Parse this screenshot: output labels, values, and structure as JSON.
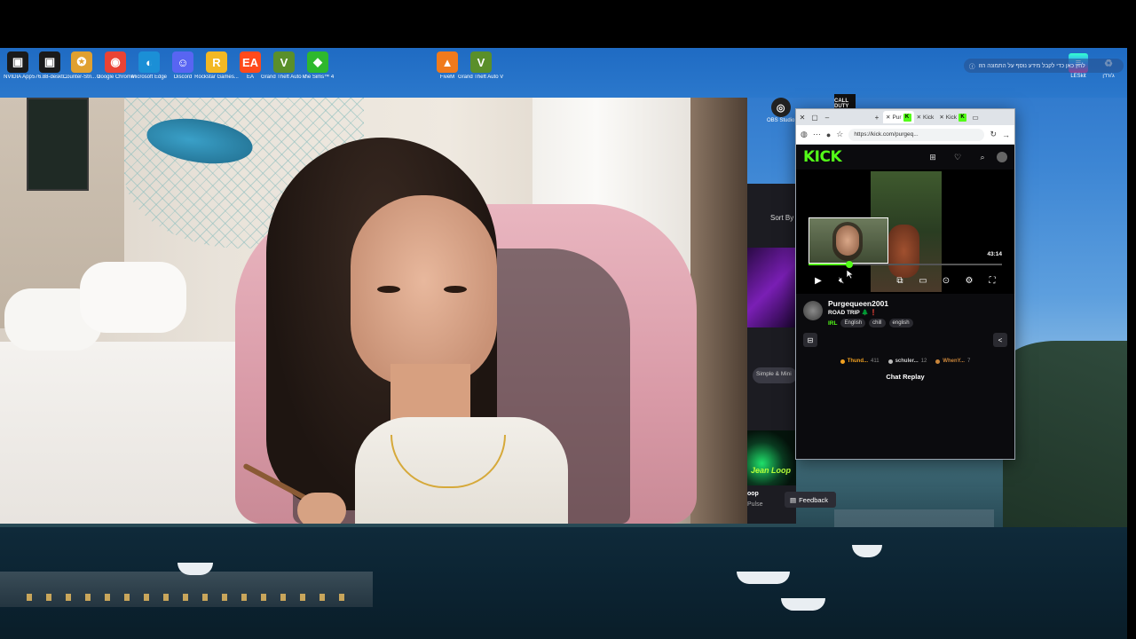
{
  "desktop": {
    "icons": [
      {
        "label": "NVIDIA App",
        "icon": "nvidia-app-icon",
        "color": "#1a1a1a",
        "glyph": "▣"
      },
      {
        "label": "576.88-deskt...",
        "icon": "nvidia-driver-icon",
        "color": "#1a1a1a",
        "glyph": "▣"
      },
      {
        "label": "Counter-Stri... 2",
        "icon": "counter-strike-icon",
        "color": "#e0a030",
        "glyph": "✪"
      },
      {
        "label": "Google Chrome",
        "icon": "chrome-icon",
        "color": "#ea4335",
        "glyph": "◉"
      },
      {
        "label": "Microsoft Edge",
        "icon": "edge-icon",
        "color": "#1b8fd6",
        "glyph": "◐"
      },
      {
        "label": "Discord",
        "icon": "discord-icon",
        "color": "#5865f2",
        "glyph": "☺"
      },
      {
        "label": "Rockstar Games...",
        "icon": "rockstar-icon",
        "color": "#f2b824",
        "glyph": "R"
      },
      {
        "label": "EA",
        "icon": "ea-icon",
        "color": "#ff4a1c",
        "glyph": "EA"
      },
      {
        "label": "Grand Theft Auto V Le...",
        "icon": "gta-v-icon",
        "color": "#5a8f2a",
        "glyph": "V"
      },
      {
        "label": "The Sims™ 4",
        "icon": "sims-icon",
        "color": "#2eb82e",
        "glyph": "◆"
      },
      {
        "label": "FiveM",
        "icon": "fivem-icon",
        "color": "#f07a1c",
        "glyph": "▲"
      },
      {
        "label": "Grand Theft Auto V Le...",
        "icon": "gta-v-icon",
        "color": "#5a8f2a",
        "glyph": "V"
      }
    ],
    "right_icons": [
      {
        "label": "OBS Studio",
        "icon": "obs-icon"
      },
      {
        "label": "CALL DUTY",
        "icon": "call-of-duty-icon"
      },
      {
        "label": "LESkit",
        "icon": "app-icon"
      },
      {
        "label": "ג'ורדן",
        "icon": "recycle-bin-icon"
      }
    ],
    "notification": "לחץ כאן כדי לקבל מידע נוסף על התמונה הזו"
  },
  "background_window": {
    "sort_label": "Sort By",
    "pill_label": "Simple & Mini",
    "thumb_text": "Jean Loop",
    "item_title": "oop",
    "item_sub": "Pulse",
    "feedback_label": "Feedback"
  },
  "browser": {
    "tabs": [
      {
        "label": "Pur",
        "active": true
      },
      {
        "label": "Kick",
        "active": false
      },
      {
        "label": "Kick",
        "active": false
      }
    ],
    "tab_badge": "K",
    "url": "https://kick.com/purgeq...",
    "kick_logo": "KICK",
    "player": {
      "timestamp": "43:14",
      "progress": 0.21
    },
    "channel": {
      "name": "Purgequeen2001",
      "title": "ROAD TRIP 🌲 ❗",
      "category": "IRL",
      "tags": [
        "English",
        "chill",
        "english"
      ]
    },
    "leaderboard": [
      {
        "name": "Thund...",
        "count": "411",
        "color": "#f0a020"
      },
      {
        "name": "schuler...",
        "count": "12",
        "color": "#bbbbbb"
      },
      {
        "name": "WhenY...",
        "count": "7",
        "color": "#c9853a"
      }
    ],
    "chat_replay_label": "Chat Replay"
  }
}
